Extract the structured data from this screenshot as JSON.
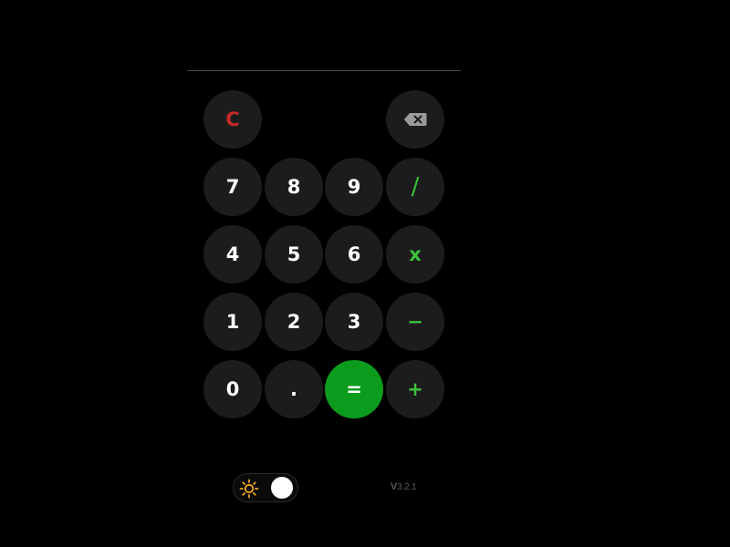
{
  "display": {
    "value": ""
  },
  "keypad": {
    "clear": "C",
    "backspace_icon": "backspace-icon",
    "digit_7": "7",
    "digit_8": "8",
    "digit_9": "9",
    "divide": "/",
    "digit_4": "4",
    "digit_5": "5",
    "digit_6": "6",
    "multiply": "x",
    "digit_1": "1",
    "digit_2": "2",
    "digit_3": "3",
    "minus": "−",
    "digit_0": "0",
    "decimal": ".",
    "equals": "=",
    "plus": "+"
  },
  "theme_toggle": {
    "icon": "sun-icon",
    "state": "light"
  },
  "version": {
    "prefix": "V",
    "number": "3.2.1"
  },
  "colors": {
    "background": "#000000",
    "button": "#1c1c1c",
    "clear": "#c62828",
    "operator": "#3cc13c",
    "equals": "#0b9c1e",
    "sun": "#f5a623"
  }
}
